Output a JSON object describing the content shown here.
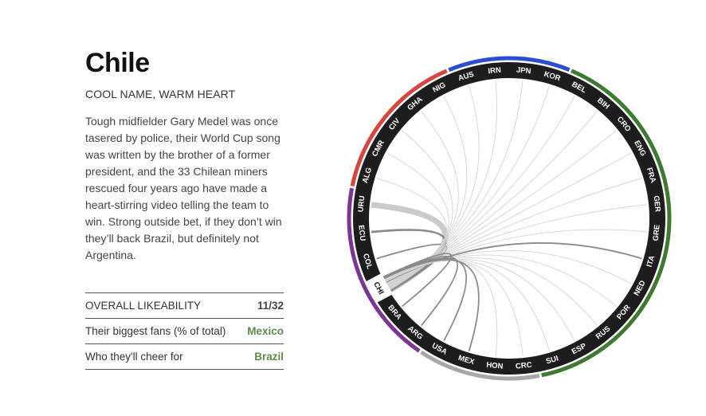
{
  "team": {
    "name": "Chile",
    "tagline": "COOL NAME, WARM HEART",
    "description": "Tough midfielder Gary Medel was once tasered by police, their World Cup song was written by the brother of a former president, and the 33 Chilean miners rescued four years ago have made a heart-stirring video telling the team to win. Strong outside bet, if they don’t win they’ll back Brazil, but definitely not Argentina."
  },
  "stats": [
    {
      "label": "OVERALL LIKEABILITY",
      "value": "11/32",
      "color": "#444444"
    },
    {
      "label": "Their biggest fans (% of total)",
      "value": "Mexico",
      "color": "#5e8a4a"
    },
    {
      "label": "Who they'll cheer for",
      "value": "Brazil",
      "color": "#5e8a4a"
    }
  ],
  "wheel": {
    "selected": "CHI",
    "teams": [
      "URU",
      "ALG",
      "CMR",
      "CIV",
      "GHA",
      "NIG",
      "AUS",
      "IRN",
      "JPN",
      "KOR",
      "BEL",
      "BIH",
      "CRO",
      "ENG",
      "FRA",
      "GER",
      "GRE",
      "ITA",
      "NED",
      "POR",
      "RUS",
      "ESP",
      "SUI",
      "CRC",
      "HON",
      "MEX",
      "USA",
      "ARG",
      "BRA",
      "CHI",
      "COL",
      "ECU"
    ],
    "groups": [
      {
        "color": "#d9443c",
        "teams": [
          "ALG",
          "CMR",
          "CIV",
          "GHA",
          "NIG"
        ]
      },
      {
        "color": "#2a4ed3",
        "teams": [
          "AUS",
          "IRN",
          "JPN",
          "KOR"
        ]
      },
      {
        "color": "#3f7a32",
        "teams": [
          "BEL",
          "BIH",
          "CRO",
          "ENG",
          "FRA",
          "GER",
          "GRE",
          "ITA",
          "NED",
          "POR",
          "RUS",
          "ESP",
          "SUI"
        ]
      },
      {
        "color": "#a7a7a7",
        "teams": [
          "CRC",
          "HON",
          "MEX",
          "USA"
        ]
      },
      {
        "color": "#7a3692",
        "teams": [
          "ARG",
          "BRA",
          "CHI",
          "COL",
          "ECU",
          "URU"
        ]
      }
    ],
    "links": [
      {
        "to": "COL",
        "weight": 2
      },
      {
        "to": "ECU",
        "weight": 3
      },
      {
        "to": "URU",
        "weight": 8
      },
      {
        "to": "ALG",
        "weight": 1
      },
      {
        "to": "CMR",
        "weight": 1
      },
      {
        "to": "CIV",
        "weight": 1
      },
      {
        "to": "GHA",
        "weight": 1
      },
      {
        "to": "NIG",
        "weight": 1
      },
      {
        "to": "AUS",
        "weight": 1
      },
      {
        "to": "IRN",
        "weight": 1
      },
      {
        "to": "JPN",
        "weight": 1
      },
      {
        "to": "KOR",
        "weight": 1
      },
      {
        "to": "BEL",
        "weight": 1
      },
      {
        "to": "BIH",
        "weight": 1
      },
      {
        "to": "CRO",
        "weight": 1
      },
      {
        "to": "ENG",
        "weight": 1
      },
      {
        "to": "FRA",
        "weight": 1
      },
      {
        "to": "GER",
        "weight": 1
      },
      {
        "to": "GRE",
        "weight": 1
      },
      {
        "to": "ITA",
        "weight": 2
      },
      {
        "to": "NED",
        "weight": 1
      },
      {
        "to": "POR",
        "weight": 1
      },
      {
        "to": "RUS",
        "weight": 1
      },
      {
        "to": "ESP",
        "weight": 1
      },
      {
        "to": "SUI",
        "weight": 1
      },
      {
        "to": "CRC",
        "weight": 1
      },
      {
        "to": "HON",
        "weight": 1
      },
      {
        "to": "MEX",
        "weight": 2
      },
      {
        "to": "USA",
        "weight": 2
      },
      {
        "to": "ARG",
        "weight": 2
      },
      {
        "to": "BRA",
        "weight": 2
      }
    ]
  }
}
